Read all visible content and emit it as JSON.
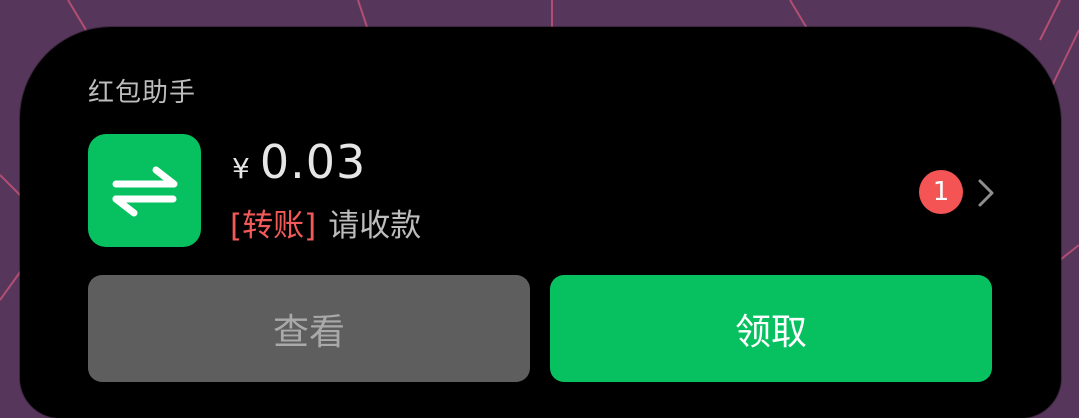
{
  "colors": {
    "card_background": "#000000",
    "accent_green": "#07c160",
    "tag_red": "#f25a5a",
    "badge_red": "#f55454",
    "secondary_button": "#5e5e5e",
    "wallpaper": "#56365a"
  },
  "notification": {
    "app_name": "红包助手",
    "icon": "transfer-arrows-icon",
    "currency_symbol": "¥",
    "amount": "0.03",
    "tag": "[转账]",
    "description": "请收款",
    "badge_count": "1",
    "expand_icon": "chevron-right-icon"
  },
  "actions": {
    "view_label": "查看",
    "claim_label": "领取"
  }
}
